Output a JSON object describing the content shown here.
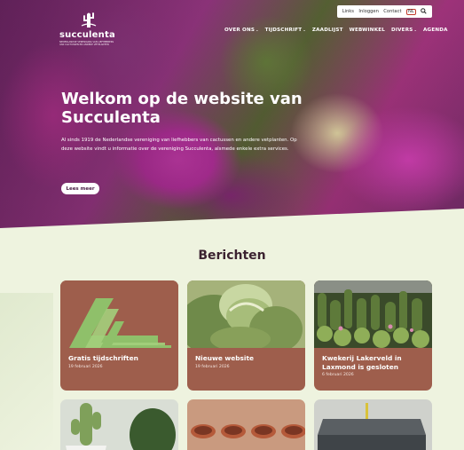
{
  "brand": {
    "name": "succulenta",
    "tagline": "NEDERLANDSE VERENIGING VAN LIEFHEBBERS VAN CACTUSSEN EN ANDERE VETPLANTEN"
  },
  "utility_nav": {
    "links": [
      "Links",
      "Inloggen",
      "Contact"
    ],
    "language_flag": "NL",
    "search_icon": "search-icon"
  },
  "main_nav": [
    {
      "label": "OVER ONS",
      "has_dropdown": true
    },
    {
      "label": "TIJDSCHRIFT",
      "has_dropdown": true
    },
    {
      "label": "ZAADLIJST",
      "has_dropdown": false
    },
    {
      "label": "WEBWINKEL",
      "has_dropdown": false
    },
    {
      "label": "DIVERS",
      "has_dropdown": true
    },
    {
      "label": "AGENDA",
      "has_dropdown": false
    }
  ],
  "hero": {
    "title": "Welkom op de website van Succulenta",
    "intro": "Al sinds 1919 de Nederlandse vereniging van liefhebbers van cactussen en andere vetplanten. Op deze website vindt u informatie over de vereniging Succulenta, alsmede enkele extra services.",
    "button": "Lees meer"
  },
  "posts": {
    "heading": "Berichten",
    "items": [
      {
        "title": "Gratis tijdschriften",
        "date": "19 februari 2026"
      },
      {
        "title": "Nieuwe website",
        "date": "19 februari 2026"
      },
      {
        "title": "Kwekerij Lakerveld in Laxmond is gesloten",
        "date": "6 februari 2026"
      }
    ]
  },
  "colors": {
    "page_bg": "#eef3df",
    "card_bg": "#9e5e4c",
    "heading": "#3b2230",
    "accent_green": "#8fc06a"
  }
}
